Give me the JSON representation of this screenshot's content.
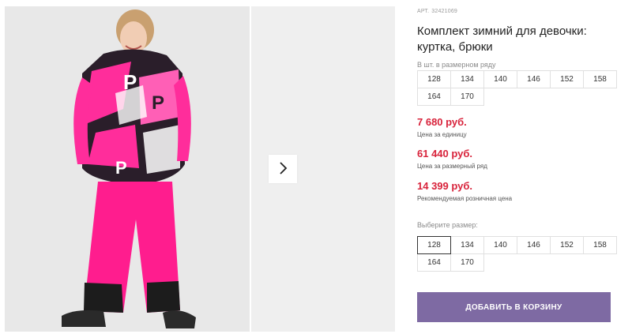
{
  "gallery": {
    "main_image": "girl-winter-suit-photo",
    "next_icon": "chevron-right-icon"
  },
  "product": {
    "article_label": "АРТ.",
    "article": "32421069",
    "title": "Комплект зимний для девочки: куртка, брюки"
  },
  "row_sizes": {
    "label": "В шт. в размерном ряду",
    "items": [
      "128",
      "134",
      "140",
      "146",
      "152",
      "158",
      "164",
      "170"
    ]
  },
  "prices": {
    "unit_price": "7 680 руб.",
    "unit_note": "Цена за единицу",
    "row_price": "61 440 руб.",
    "row_note": "Цена за размерный ряд",
    "retail_price": "14 399 руб.",
    "retail_note": "Рекомендуемая розничная цена"
  },
  "size_select": {
    "label": "Выберите размер:",
    "items": [
      "128",
      "134",
      "140",
      "146",
      "152",
      "158",
      "164",
      "170"
    ],
    "selected": "128"
  },
  "cart": {
    "button_label": "ДОБАВИТЬ В КОРЗИНУ"
  },
  "colors": {
    "price": "#d8233b",
    "button": "#7e6aa3",
    "jacket_pink": "#ff2d9b"
  }
}
